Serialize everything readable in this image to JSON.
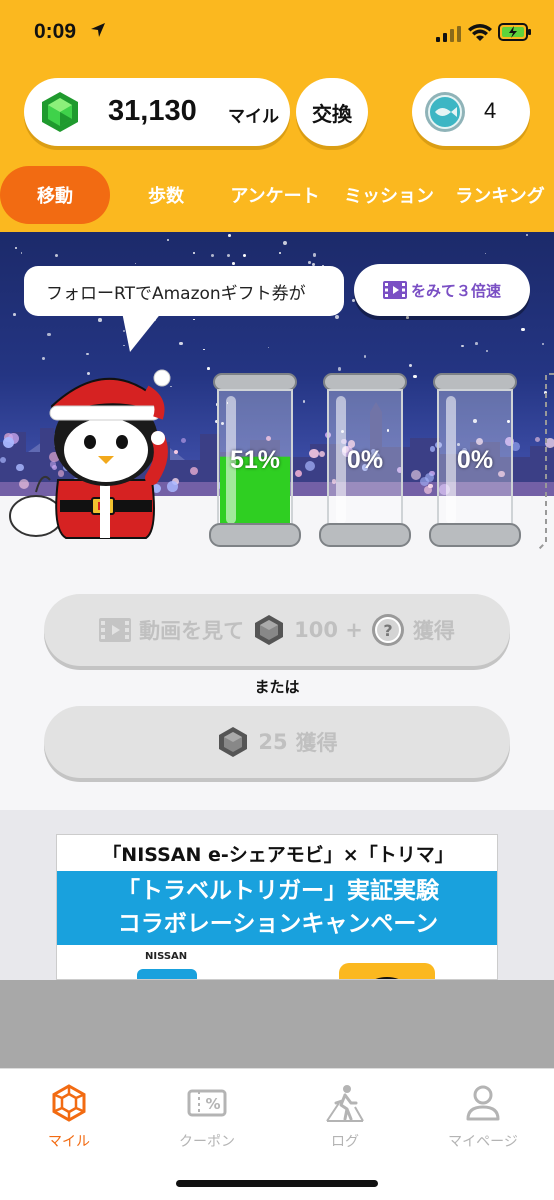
{
  "status_bar": {
    "time": "0:09"
  },
  "header": {
    "miles_value": "31,130",
    "miles_unit": "マイル",
    "exchange_label": "交換",
    "coin_count": "4"
  },
  "tabs": [
    {
      "label": "移動",
      "active": true
    },
    {
      "label": "歩数",
      "active": false
    },
    {
      "label": "アンケート",
      "active": false
    },
    {
      "label": "ミッション",
      "active": false
    },
    {
      "label": "ランキング",
      "active": false
    }
  ],
  "scene": {
    "speech_bubble": "フォローRTでAmazonギフト券が",
    "speed_button_label": "をみて３倍速",
    "tanks": [
      {
        "percent_label": "51%",
        "fill_fraction": 0.51,
        "fill_color": "#2fcf22"
      },
      {
        "percent_label": "0%",
        "fill_fraction": 0.0,
        "fill_color": "#2fcf22"
      },
      {
        "percent_label": "0%",
        "fill_fraction": 0.0,
        "fill_color": "#2fcf22"
      }
    ]
  },
  "actions": {
    "video_button": {
      "prefix": "動画を見て",
      "amount": "100 +",
      "suffix": "獲得"
    },
    "or_label": "または",
    "plain_button": {
      "amount": "25",
      "suffix": "獲得"
    }
  },
  "banner": {
    "top_line": "「NISSAN e-シェアモビ」×「トリマ」",
    "line1": "「トラベルトリガー」実証実験",
    "line2": "コラボレーションキャンペーン",
    "brand": "NISSAN"
  },
  "bottom_nav": [
    {
      "label": "マイル",
      "icon": "miles-hex-icon",
      "active": true
    },
    {
      "label": "クーポン",
      "icon": "coupon-icon",
      "active": false
    },
    {
      "label": "ログ",
      "icon": "walking-log-icon",
      "active": false
    },
    {
      "label": "マイページ",
      "icon": "person-icon",
      "active": false
    }
  ],
  "colors": {
    "header_yellow": "#fbb81f",
    "active_orange": "#f26b12",
    "banner_blue": "#19a1dd",
    "speed_purple": "#7a4fc4"
  }
}
